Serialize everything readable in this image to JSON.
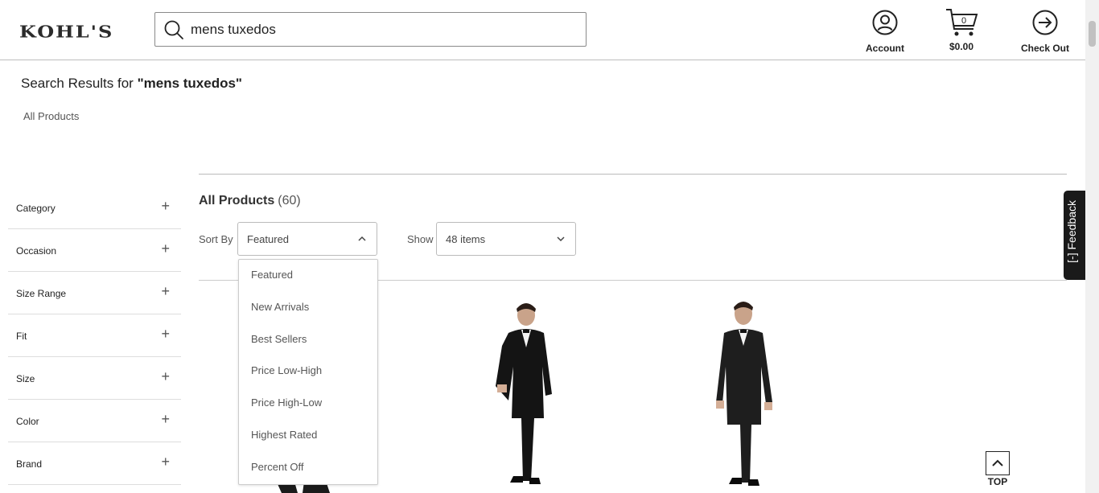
{
  "header": {
    "logo": "KOHL'S",
    "search_value": "mens tuxedos",
    "account_label": "Account",
    "cart_count": "0",
    "cart_total": "$0.00",
    "checkout_label": "Check Out"
  },
  "results": {
    "prefix": "Search Results for ",
    "query": "\"mens tuxedos\"",
    "breadcrumb": "All Products"
  },
  "sidebar": {
    "facets": [
      {
        "label": "Category"
      },
      {
        "label": "Occasion"
      },
      {
        "label": "Size Range"
      },
      {
        "label": "Fit"
      },
      {
        "label": "Size"
      },
      {
        "label": "Color"
      },
      {
        "label": "Brand"
      }
    ],
    "plus": "+"
  },
  "main": {
    "title": "All Products",
    "count": "(60)",
    "sort_label": "Sort By",
    "sort_value": "Featured",
    "show_label": "Show",
    "show_value": "48 items",
    "sort_options": [
      "Featured",
      "New Arrivals",
      "Best Sellers",
      "Price Low-High",
      "Price High-Low",
      "Highest Rated",
      "Percent Off"
    ]
  },
  "feedback_label": "[-] Feedback",
  "top_label": "TOP"
}
